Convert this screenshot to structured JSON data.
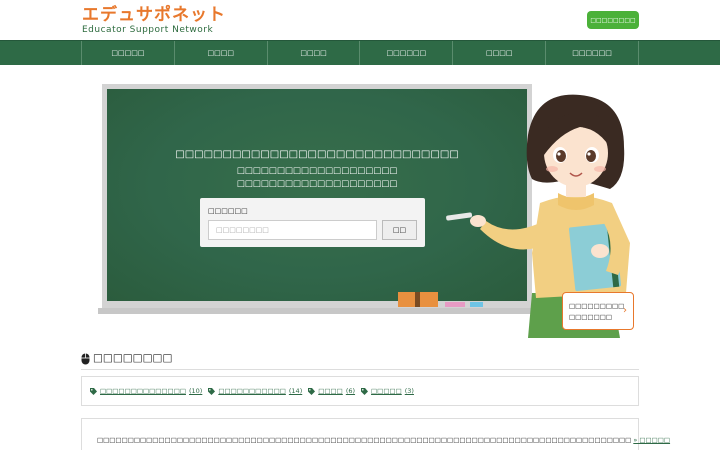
{
  "header": {
    "logo_jp": "エデュサポネット",
    "logo_en": "Educator Support Network",
    "action_button": "□□□□□□□□"
  },
  "nav": {
    "items": [
      {
        "label": "□□□□□"
      },
      {
        "label": "□□□□"
      },
      {
        "label": "□□□□"
      },
      {
        "label": "□□□□□□"
      },
      {
        "label": "□□□□"
      },
      {
        "label": "□□□□□□"
      }
    ]
  },
  "hero": {
    "title": "□□□□□□□□□□□□□□□□□□□□□□□□□□□□□□",
    "sub_line1": "□□□□□□□□□□□□□□□□□□□□",
    "sub_line2": "□□□□□□□□□□□□□□□□□□□□",
    "search": {
      "label": "□□□□□□",
      "placeholder": "□□□□□□□□",
      "button": "□□"
    },
    "cta": {
      "line1": "□□□□□□□□□",
      "line2": "□□□□□□□",
      "arrow": "›"
    },
    "colors": {
      "board": "#30664a",
      "eraser_orange": "#e8903f",
      "chalk_pink": "#e79bc4",
      "chalk_blue": "#6ec4e5"
    }
  },
  "keywords": {
    "title": "□□□□□□□□",
    "tags": [
      {
        "label": "□□□□□□□□□□□□□□",
        "count": "(10)"
      },
      {
        "label": "□□□□□□□□□□□",
        "count": "(14)"
      },
      {
        "label": "□□□□",
        "count": "(6)"
      },
      {
        "label": "□□□□□",
        "count": "(3)"
      }
    ]
  },
  "intro": {
    "text": "□□□□□□□□□□□□□□□□□□□□□□□□□□□□□□□□□□□□□□□□□□□□□□□□□□□□□□□□□□□□□□□□□□□□□□□□□□□□□□□□□□□□□□□",
    "link": "» □□□□□"
  },
  "icons": {
    "keyword_heading": "mouse-icon",
    "tag": "tag-icon",
    "cta_arrow": "chevron-right-icon"
  },
  "theme": {
    "accent_orange": "#e8782c",
    "nav_green": "#2e6a46",
    "button_green": "#4bb139"
  }
}
